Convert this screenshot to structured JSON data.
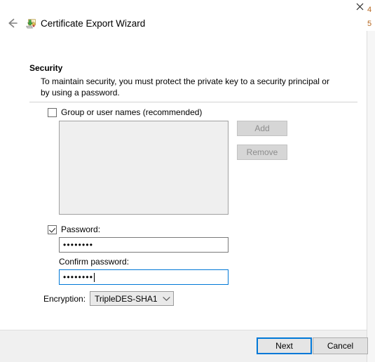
{
  "window": {
    "title": "Certificate Export Wizard",
    "back_icon": "back-arrow-icon",
    "app_icon": "certificate-export-icon",
    "close_icon": "close-icon"
  },
  "page": {
    "heading": "Security",
    "description": "To maintain security, you must protect the private key to a security principal or by using a password."
  },
  "group_names": {
    "checkbox_label": "Group or user names (recommended)",
    "checked": false,
    "list_items": [],
    "add_label": "Add",
    "remove_label": "Remove",
    "add_enabled": false,
    "remove_enabled": false
  },
  "password": {
    "checkbox_label": "Password:",
    "checked": true,
    "value": "••••••••",
    "confirm_label": "Confirm password:",
    "confirm_value": "••••••••",
    "confirm_focused": true
  },
  "encryption": {
    "label": "Encryption:",
    "selected": "TripleDES-SHA1",
    "arrow_icon": "chevron-down-icon"
  },
  "footer": {
    "next_label": "Next",
    "cancel_label": "Cancel",
    "next_is_default": true
  },
  "background_window": {
    "fragment_top": "4",
    "fragment_bottom": "5"
  },
  "colors": {
    "accent": "#0078d7",
    "footer_bg": "#f0f0f0",
    "disabled_text": "#8d8d8d",
    "disabled_bg": "#efefef"
  }
}
